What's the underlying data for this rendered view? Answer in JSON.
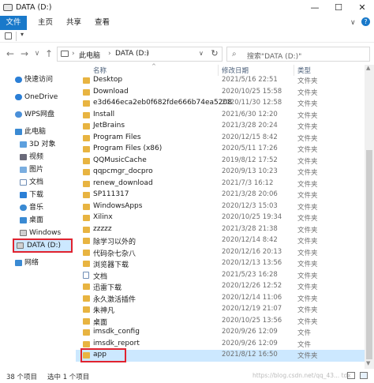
{
  "window": {
    "title": "DATA (D:)",
    "minimize": "—",
    "maximize": "☐",
    "close": "✕"
  },
  "ribbon": {
    "tabs": [
      "文件",
      "主页",
      "共享",
      "查看"
    ]
  },
  "qat": {
    "dropdown": "▾"
  },
  "address": {
    "back": "←",
    "forward": "→",
    "down": "∨",
    "up": "↑",
    "crumbs": [
      "此电脑",
      "DATA (D:)"
    ],
    "sep": "›",
    "refresh": "↻",
    "chev": "∨"
  },
  "search": {
    "placeholder": "搜索\"DATA (D:)\""
  },
  "nav": {
    "items": [
      {
        "label": "快速访问",
        "icon": "star-icon"
      },
      {
        "label": "OneDrive",
        "icon": "cloud-icon"
      },
      {
        "label": "WPS网盘",
        "icon": "cloud-icon"
      },
      {
        "label": "此电脑",
        "icon": "computer-icon"
      },
      {
        "label": "3D 对象",
        "icon": "cube-icon"
      },
      {
        "label": "视频",
        "icon": "video-icon"
      },
      {
        "label": "图片",
        "icon": "picture-icon"
      },
      {
        "label": "文档",
        "icon": "document-icon"
      },
      {
        "label": "下载",
        "icon": "download-icon"
      },
      {
        "label": "音乐",
        "icon": "music-icon"
      },
      {
        "label": "桌面",
        "icon": "desktop-icon"
      },
      {
        "label": "Windows (C:)",
        "icon": "drive-icon"
      },
      {
        "label": "DATA (D:)",
        "icon": "drive-icon"
      },
      {
        "label": "网络",
        "icon": "network-icon"
      }
    ]
  },
  "columns": {
    "name": "名称",
    "date": "修改日期",
    "type": "类型",
    "sort": "^"
  },
  "files": [
    {
      "name": "Desktop",
      "date": "2021/5/16 22:51",
      "type": "文件夹",
      "kind": "folder"
    },
    {
      "name": "Download",
      "date": "2020/10/25 15:58",
      "type": "文件夹",
      "kind": "folder"
    },
    {
      "name": "e3d646eca2eb0f682fde666b74ea5208",
      "date": "2020/11/30 12:58",
      "type": "文件夹",
      "kind": "folder"
    },
    {
      "name": "Install",
      "date": "2021/6/30 12:20",
      "type": "文件夹",
      "kind": "folder"
    },
    {
      "name": "JetBrains",
      "date": "2021/3/28 20:24",
      "type": "文件夹",
      "kind": "folder"
    },
    {
      "name": "Program Files",
      "date": "2020/12/15 8:42",
      "type": "文件夹",
      "kind": "folder"
    },
    {
      "name": "Program Files (x86)",
      "date": "2020/5/11 17:26",
      "type": "文件夹",
      "kind": "folder"
    },
    {
      "name": "QQMusicCache",
      "date": "2019/8/12 17:52",
      "type": "文件夹",
      "kind": "folder"
    },
    {
      "name": "qqpcmgr_docpro",
      "date": "2020/9/13 10:23",
      "type": "文件夹",
      "kind": "folder"
    },
    {
      "name": "renew_download",
      "date": "2021/7/3 16:12",
      "type": "文件夹",
      "kind": "folder"
    },
    {
      "name": "SP111317",
      "date": "2021/3/28 20:06",
      "type": "文件夹",
      "kind": "folder"
    },
    {
      "name": "WindowsApps",
      "date": "2020/12/3 15:03",
      "type": "文件夹",
      "kind": "folder"
    },
    {
      "name": "Xilinx",
      "date": "2020/10/25 19:34",
      "type": "文件夹",
      "kind": "folder"
    },
    {
      "name": "zzzzz",
      "date": "2021/3/28 21:38",
      "type": "文件夹",
      "kind": "folder"
    },
    {
      "name": "除学习以外的",
      "date": "2020/12/14 8:42",
      "type": "文件夹",
      "kind": "folder"
    },
    {
      "name": "代码杂七杂八",
      "date": "2020/12/16 20:13",
      "type": "文件夹",
      "kind": "folder"
    },
    {
      "name": "浏览器下载",
      "date": "2020/12/13 13:56",
      "type": "文件夹",
      "kind": "folder"
    },
    {
      "name": "文档",
      "date": "2021/5/23 16:28",
      "type": "文件夹",
      "kind": "doc"
    },
    {
      "name": "迅雷下载",
      "date": "2020/12/26 12:52",
      "type": "文件夹",
      "kind": "folder"
    },
    {
      "name": "永久激活插件",
      "date": "2020/12/14 11:06",
      "type": "文件夹",
      "kind": "folder"
    },
    {
      "name": "朱神凡",
      "date": "2020/12/19 21:07",
      "type": "文件夹",
      "kind": "folder"
    },
    {
      "name": "桌面",
      "date": "2020/10/25 13:56",
      "type": "文件夹",
      "kind": "folder"
    },
    {
      "name": "imsdk_config",
      "date": "2020/9/26 12:09",
      "type": "文件",
      "kind": "folder"
    },
    {
      "name": "imsdk_report",
      "date": "2020/9/26 12:09",
      "type": "文件",
      "kind": "folder"
    },
    {
      "name": "app",
      "date": "2021/8/12 16:50",
      "type": "文件夹",
      "kind": "folder"
    }
  ],
  "status": {
    "count": "38 个项目",
    "selected": "选中 1 个项目",
    "watermark": "https://blog.csdn.net/qq_43... tdx"
  },
  "colors": {
    "accent": "#1979ca",
    "highlight": "#e0232f",
    "folder": "#e8b441",
    "selected": "#cce8ff"
  }
}
